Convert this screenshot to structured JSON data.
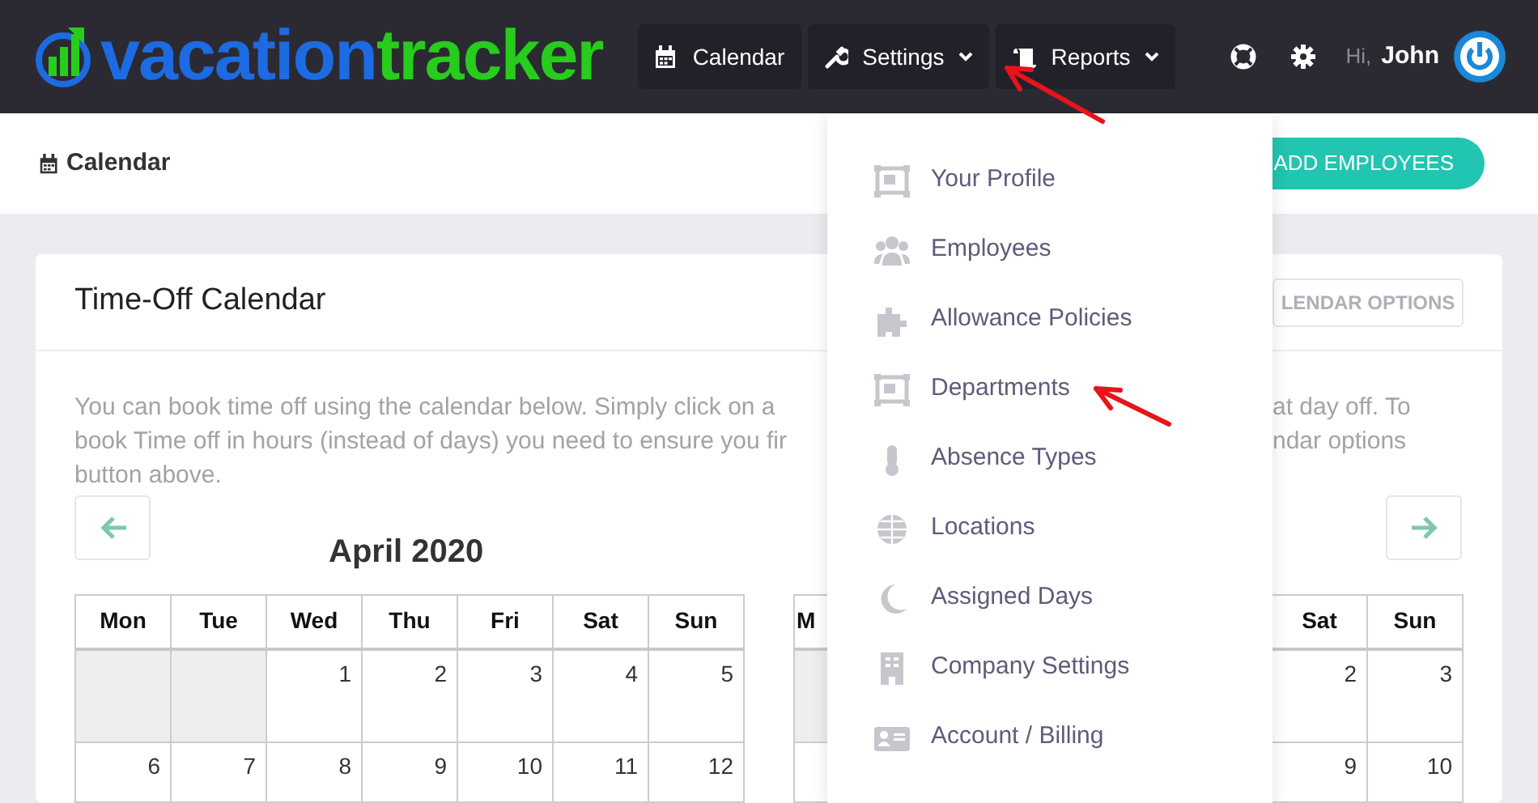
{
  "navbar": {
    "logo": {
      "part_1": "vacation",
      "part_2": "tracker"
    },
    "nav_items": [
      {
        "label": "Calendar",
        "kind": "link"
      },
      {
        "label": "Settings",
        "kind": "menu"
      },
      {
        "label": "Reports",
        "kind": "menu"
      }
    ],
    "greeting": "Hi,",
    "user_name": "John"
  },
  "subheader": {
    "title": "Calendar",
    "button": "ADD EMPLOYEES"
  },
  "card": {
    "title": "Time-Off Calendar",
    "options_button": "LENDAR OPTIONS",
    "intro_left": [
      "You can book time off using the calendar below. Simply click on a",
      "book Time off in hours (instead of days) you need to ensure you fir",
      "button above."
    ],
    "intro_right": [
      "at day off. To",
      "ndar options"
    ],
    "calendars": [
      {
        "title": "April 2020",
        "kind": "previous",
        "weekdays": [
          "Mon",
          "Tue",
          "Wed",
          "Thu",
          "Fri",
          "Sat",
          "Sun"
        ],
        "weeks": [
          [
            {
              "muted": true
            },
            {
              "muted": true
            },
            {
              "day": "1",
              "muted": false
            },
            {
              "day": "2",
              "muted": false
            },
            {
              "day": "3",
              "muted": false
            },
            {
              "day": "4",
              "muted": false
            },
            {
              "day": "5",
              "muted": false
            }
          ],
          [
            {
              "day": "6",
              "muted": false
            },
            {
              "day": "7",
              "muted": false
            },
            {
              "day": "8",
              "muted": false
            },
            {
              "day": "9",
              "muted": false
            },
            {
              "day": "10",
              "muted": false
            },
            {
              "day": "11",
              "muted": false
            },
            {
              "day": "12",
              "muted": false
            }
          ]
        ]
      },
      {
        "kind": "next",
        "weekdays": [
          "M",
          "Sat",
          "Sun"
        ],
        "weeks": [
          [
            {
              "muted": true
            },
            {
              "day": "2",
              "muted": false
            },
            {
              "day": "3",
              "muted": false
            }
          ],
          [
            {
              "muted": false
            },
            {
              "day": "9",
              "muted": false
            },
            {
              "day": "10",
              "muted": false
            }
          ]
        ]
      }
    ]
  },
  "settings_menu": {
    "items": [
      {
        "label": "Your Profile"
      },
      {
        "label": "Employees"
      },
      {
        "label": "Allowance Policies"
      },
      {
        "label": "Departments"
      },
      {
        "label": "Absence Types"
      },
      {
        "label": "Locations"
      },
      {
        "label": "Assigned Days"
      },
      {
        "label": "Company Settings"
      },
      {
        "label": "Account / Billing"
      }
    ]
  },
  "annotations": [
    {
      "kind": "arrow"
    },
    {
      "kind": "arrow"
    }
  ]
}
